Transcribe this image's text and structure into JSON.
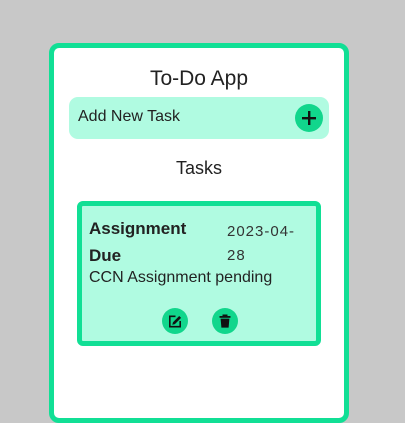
{
  "app": {
    "title": "To-Do App"
  },
  "add_task": {
    "label": "Add New Task",
    "button_icon": "plus-icon"
  },
  "tasks_section": {
    "heading": "Tasks",
    "items": [
      {
        "title": "Assignment Due",
        "date": "2023-04-28",
        "description": "CCN Assignment pending",
        "actions": [
          {
            "name": "edit",
            "icon": "edit-icon"
          },
          {
            "name": "delete",
            "icon": "trash-icon"
          }
        ]
      }
    ]
  },
  "colors": {
    "accent": "#11df95",
    "card_background": "#b0fbe1",
    "page_background": "#c8c8c8"
  }
}
